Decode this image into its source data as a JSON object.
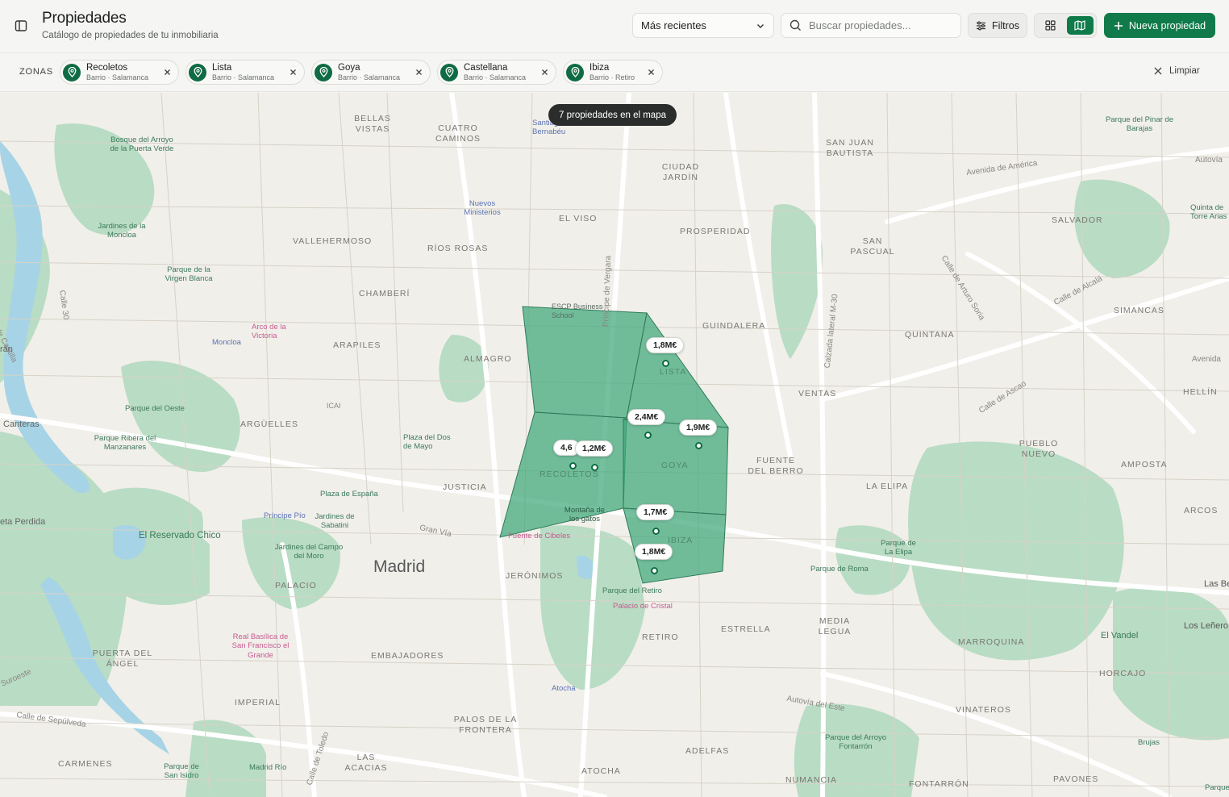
{
  "header": {
    "title": "Propiedades",
    "subtitle": "Catálogo de propiedades de tu inmobiliaria",
    "sort_value": "Más recientes",
    "search_placeholder": "Buscar propiedades...",
    "filters_label": "Filtros",
    "new_label": "Nueva propiedad",
    "accent": "#107a4a"
  },
  "zones": {
    "label": "ZONAS",
    "clear_label": "Limpiar",
    "chips": [
      {
        "name": "Recoletos",
        "sub": "Barrio · Salamanca"
      },
      {
        "name": "Lista",
        "sub": "Barrio · Salamanca"
      },
      {
        "name": "Goya",
        "sub": "Barrio · Salamanca"
      },
      {
        "name": "Castellana",
        "sub": "Barrio · Salamanca"
      },
      {
        "name": "Ibiza",
        "sub": "Barrio · Retiro"
      }
    ]
  },
  "map": {
    "count_label": "7 propiedades en el mapa",
    "zone_fill": "#3fa77a",
    "prices": [
      "1,8M€",
      "2,4M€",
      "1,9M€",
      "4,6",
      "1,2M€",
      "1,7M€",
      "1,8M€"
    ],
    "city": "Madrid",
    "districts": [
      "BELLAS VISTAS",
      "CUATRO CAMINOS",
      "SAN JUAN BAUTISTA",
      "CIUDAD JARDÍN",
      "EL VISO",
      "PROSPERIDAD",
      "SAN PASCUAL",
      "SALVADOR",
      "VALLEHERMOSO",
      "RÍOS ROSAS",
      "CHAMBERÍ",
      "GUINDALERA",
      "QUINTANA",
      "SIMANCAS",
      "ARAPILES",
      "ALMAGRO",
      "LISTA",
      "VENTAS",
      "HELLÍN",
      "ARGÜELLES",
      "GOYA",
      "FUENTE DEL BERRO",
      "PUEBLO NUEVO",
      "AMPOSTA",
      "JUSTICIA",
      "RECOLETOS",
      "LA ELIPA",
      "ARCOS",
      "IBIZA",
      "PALACIO",
      "JERÓNIMOS",
      "ESTRELLA",
      "MEDIA LEGUA",
      "RETIRO",
      "MARROQUINA",
      "PUERTA DEL ÁNGEL",
      "EMBAJADORES",
      "HORCAJO",
      "IMPERIAL",
      "VINATEROS",
      "PALOS DE LA FRONTERA",
      "CARMENES",
      "LAS ACACIAS",
      "ADELFAS",
      "ATOCHA",
      "NUMANCIA",
      "FONTARRÓN",
      "PAVONES"
    ],
    "places": [
      "Bosque del Arroyo de la Puerta Verde",
      "Jardines de la Moncloa",
      "Parque de la Virgen Blanca",
      "Parque del Oeste",
      "Parque Ribera del Manzanares",
      "Plaza del Dos de Mayo",
      "Plaza de España",
      "Jardines de Sabatini",
      "Jardines del Campo del Moro",
      "El Reservado Chico",
      "Parque del Retiro",
      "Parque de La Elipa",
      "Parque de Roma",
      "Parque del Pinar de Barajas",
      "Quinta de Torre Arias",
      "Parque del Arroyo Fontarrón",
      "Parque de San Isidro",
      "Madrid Río",
      "El Vandel",
      "Brujas",
      "Montaña de los gatos",
      "Las Be",
      "Los Leñero",
      "Parque Fore"
    ],
    "pink_places": [
      "Arco de la Victoria",
      "Fuente de Cibeles",
      "Palacio de Cristal",
      "Real Basílica de San Francisco el Grande"
    ],
    "blue_places": [
      "Moncloa",
      "Nuevos Ministerios",
      "Santiago Bernabéu",
      "Príncipe Pío",
      "Atocha"
    ],
    "roads": [
      "Avenida de América",
      "Calle de Arturo Soria",
      "Calle de Alcalá",
      "Calle de Ascao",
      "Calzada lateral M-30",
      "Gran Vía",
      "Calle de Sepúlveda",
      "Autovía del Este",
      "Calle de Toledo",
      "Carretera de Castilla",
      "Calle 30",
      "Príncipe de Vergara",
      "Canteras",
      "eta Perdida",
      "ICAI",
      "ESCP Business School",
      "Suroeste",
      "Avenida",
      "Autovía",
      "rán"
    ]
  }
}
